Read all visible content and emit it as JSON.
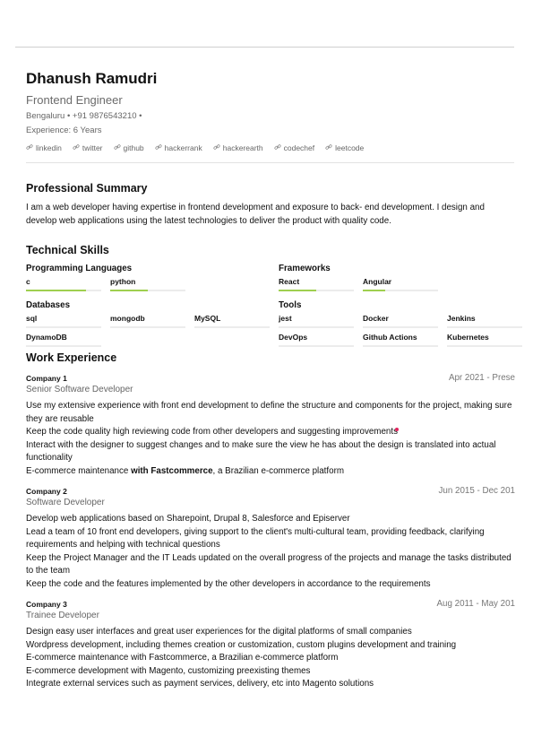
{
  "header": {
    "name": "Dhanush Ramudri",
    "role": "Frontend Engineer",
    "location_phone": "Bengaluru • +91 9876543210 •",
    "experience": "Experience: 6 Years",
    "links": [
      "linkedin",
      "twitter",
      "github",
      "hackerrank",
      "hackerearth",
      "codechef",
      "leetcode"
    ]
  },
  "summary": {
    "heading": "Professional Summary",
    "text": "I am a web developer having expertise in frontend development and exposure to back- end development. I design and develop web applications using the latest technologies to deliver the product with quality code."
  },
  "skills": {
    "heading": "Technical Skills",
    "groups": [
      {
        "title": "Programming Languages",
        "items": [
          {
            "name": "c",
            "level": 0.8
          },
          {
            "name": "python",
            "level": 0.5
          }
        ]
      },
      {
        "title": "Frameworks",
        "items": [
          {
            "name": "React",
            "level": 0.5
          },
          {
            "name": "Angular",
            "level": 0.3
          }
        ]
      },
      {
        "title": "Databases",
        "items": [
          {
            "name": "sql",
            "level": 0
          },
          {
            "name": "mongodb",
            "level": 0
          },
          {
            "name": "MySQL",
            "level": 0
          },
          {
            "name": "DynamoDB",
            "level": 0
          }
        ]
      },
      {
        "title": "Tools",
        "items": [
          {
            "name": "jest",
            "level": 0
          },
          {
            "name": "Docker",
            "level": 0
          },
          {
            "name": "Jenkins",
            "level": 0
          },
          {
            "name": "DevOps",
            "level": 0
          },
          {
            "name": "Github Actions",
            "level": 0
          },
          {
            "name": "Kubernetes",
            "level": 0
          }
        ]
      }
    ]
  },
  "experience": {
    "heading": "Work Experience",
    "jobs": [
      {
        "company": "Company 1",
        "title": "Senior Software Developer",
        "dates": "Apr 2021 - Prese",
        "bullets": [
          "Use my extensive experience with front end development to define the structure and components for the project, making sure they are reusable",
          "Keep the code quality high reviewing code from other developers and suggesting improvements",
          "Interact with the designer to suggest changes and to make sure the view he has about the design is translated into actual functionality"
        ],
        "last_pre": "E-commerce maintenance ",
        "last_bold": "with Fastcommerce",
        "last_post": ", a Brazilian e-commerce platform"
      },
      {
        "company": "Company 2",
        "title": "Software Developer",
        "dates": "Jun 2015 - Dec 201",
        "bullets": [
          "Develop web applications based on Sharepoint, Drupal 8, Salesforce and Episerver",
          "Lead a team of 10 front end developers, giving support to the client's multi-cultural team, providing feedback, clarifying requirements and helping with technical questions",
          "Keep the Project Manager and the IT Leads updated on the overall progress of the projects and manage the tasks distributed to the team",
          "Keep the code and the features implemented by the other developers in accordance to the requirements"
        ]
      },
      {
        "company": "Company 3",
        "title": "Trainee Developer",
        "dates": "Aug 2011 - May 201",
        "bullets": [
          "Design easy user interfaces and great user experiences for the digital platforms of small companies",
          "Wordpress development, including themes creation or customization, custom plugins development and training",
          "E-commerce maintenance with Fastcommerce, a Brazilian e-commerce platform",
          "E-commerce development with Magento, customizing preexisting themes",
          "Integrate external services such as payment services, delivery, etc into Magento solutions"
        ]
      }
    ]
  },
  "colors": {
    "accent": "#9fcf4f",
    "muted": "#666666",
    "marker": "#e0245e"
  }
}
